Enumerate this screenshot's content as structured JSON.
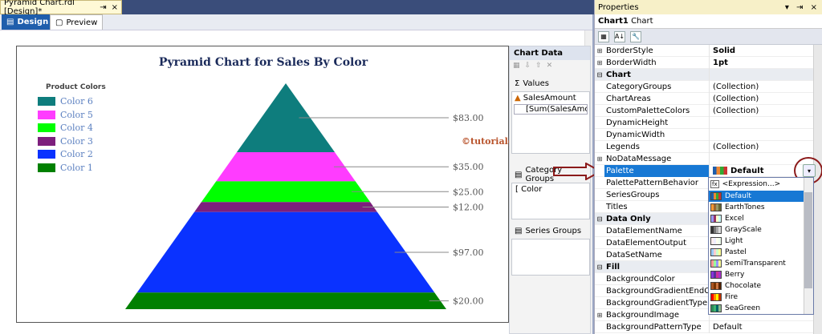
{
  "doc_tab": {
    "title": "Pyramid Chart.rdl [Design]*",
    "pin": "⇥",
    "close": "×"
  },
  "editor_tabs": [
    {
      "label": "Design"
    },
    {
      "label": "Preview"
    }
  ],
  "chart": {
    "title": "Pyramid Chart for Sales By Color",
    "legend_title": "Product Colors",
    "watermark": "©tutorialgateway.org"
  },
  "chart_data": {
    "type": "pyramid",
    "title": "Pyramid Chart for Sales By Color",
    "legend_title": "Product Colors",
    "categories": [
      "Color 6",
      "Color 5",
      "Color 4",
      "Color 3",
      "Color 2",
      "Color 1"
    ],
    "values": [
      83.0,
      35.0,
      25.0,
      12.0,
      97.0,
      20.0
    ],
    "labels": [
      "$83.00",
      "$35.00",
      "$25.00",
      "$12.00",
      "$97.00",
      "$20.00"
    ],
    "colors": [
      "#0e7d7d",
      "#ff3cff",
      "#00ff00",
      "#7d1f7d",
      "#0a32ff",
      "#008000"
    ]
  },
  "chart_data_pane": {
    "title": "Chart Data",
    "values_label": "Values",
    "values_field": "SalesAmount",
    "values_expr": "[Sum(SalesAmount)]",
    "category_groups_label": "Category Groups",
    "category_item": "Color",
    "series_groups_label": "Series Groups"
  },
  "properties": {
    "header": "Properties",
    "pins": "▾ ⇥ ×",
    "selected_object": "Chart1",
    "selected_type": "Chart",
    "rows": [
      {
        "expander": "⊞",
        "name": "BorderStyle",
        "value": "Solid",
        "bold": true
      },
      {
        "expander": "⊞",
        "name": "BorderWidth",
        "value": "1pt",
        "bold": true
      },
      {
        "expander": "⊟",
        "name": "Chart",
        "value": "",
        "category": true
      },
      {
        "expander": "",
        "name": "CategoryGroups",
        "value": "(Collection)"
      },
      {
        "expander": "",
        "name": "ChartAreas",
        "value": "(Collection)"
      },
      {
        "expander": "",
        "name": "CustomPaletteColors",
        "value": "(Collection)"
      },
      {
        "expander": "",
        "name": "DynamicHeight",
        "value": ""
      },
      {
        "expander": "",
        "name": "DynamicWidth",
        "value": ""
      },
      {
        "expander": "",
        "name": "Legends",
        "value": "(Collection)"
      },
      {
        "expander": "⊞",
        "name": "NoDataMessage",
        "value": ""
      },
      {
        "expander": "",
        "name": "Palette",
        "value": "Default",
        "selected": true
      },
      {
        "expander": "",
        "name": "PalettePatternBehavior",
        "value": ""
      },
      {
        "expander": "",
        "name": "SeriesGroups",
        "value": ""
      },
      {
        "expander": "",
        "name": "Titles",
        "value": ""
      },
      {
        "expander": "⊟",
        "name": "Data Only",
        "value": "",
        "category": true
      },
      {
        "expander": "",
        "name": "DataElementName",
        "value": ""
      },
      {
        "expander": "",
        "name": "DataElementOutput",
        "value": ""
      },
      {
        "expander": "",
        "name": "DataSetName",
        "value": ""
      },
      {
        "expander": "⊟",
        "name": "Fill",
        "value": "",
        "category": true
      },
      {
        "expander": "",
        "name": "BackgroundColor",
        "value": ""
      },
      {
        "expander": "",
        "name": "BackgroundGradientEndColor",
        "value": ""
      },
      {
        "expander": "",
        "name": "BackgroundGradientType",
        "value": ""
      },
      {
        "expander": "⊞",
        "name": "BackgroundImage",
        "value": ""
      },
      {
        "expander": "",
        "name": "BackgroundPatternType",
        "value": "Default"
      }
    ]
  },
  "palette_dropdown": {
    "expression": "<Expression...>",
    "options": [
      {
        "label": "Default",
        "highlight": true,
        "colors": [
          "#1f5eac",
          "#e83",
          "#3a3",
          "#c33"
        ]
      },
      {
        "label": "EarthTones",
        "colors": [
          "#f93",
          "#963",
          "#996",
          "#663"
        ]
      },
      {
        "label": "Excel",
        "colors": [
          "#99f",
          "#936",
          "#ffc",
          "#cff"
        ]
      },
      {
        "label": "GrayScale",
        "colors": [
          "#333",
          "#777",
          "#aaa",
          "#ddd"
        ]
      },
      {
        "label": "Light",
        "colors": [
          "#fee",
          "#eef",
          "#ffe",
          "#efe"
        ]
      },
      {
        "label": "Pastel",
        "colors": [
          "#9cf",
          "#fcc",
          "#cfc",
          "#ff9"
        ]
      },
      {
        "label": "SemiTransparent",
        "colors": [
          "#f99",
          "#9f9",
          "#99f",
          "#ff9"
        ]
      },
      {
        "label": "Berry",
        "colors": [
          "#83d",
          "#539",
          "#c39",
          "#a3c"
        ]
      },
      {
        "label": "Chocolate",
        "colors": [
          "#a52",
          "#730",
          "#c74",
          "#520"
        ]
      },
      {
        "label": "Fire",
        "colors": [
          "#f00",
          "#f80",
          "#ff0",
          "#c30"
        ]
      },
      {
        "label": "SeaGreen",
        "colors": [
          "#2e8b57",
          "#3cb371",
          "#066",
          "#8fbc8f"
        ]
      }
    ]
  },
  "colors": {
    "accent": "#1778d4",
    "arrow": "#8b1a1a",
    "title": "#1a2a5a"
  }
}
